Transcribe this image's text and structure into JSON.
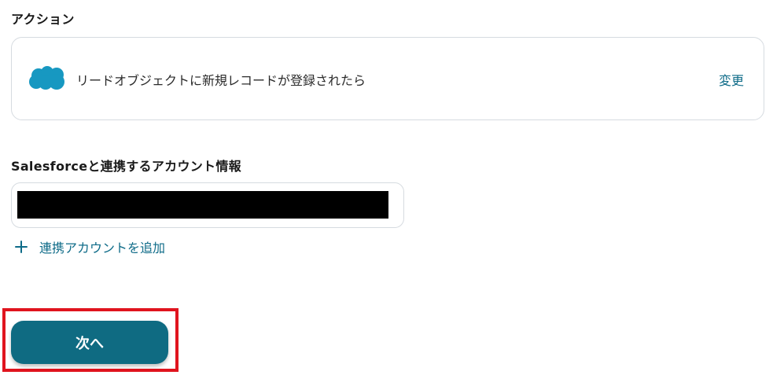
{
  "action_section": {
    "label": "アクション",
    "card": {
      "logo_icon": "salesforce-cloud-icon",
      "text": "リードオブジェクトに新規レコードが登録されたら",
      "change_label": "変更"
    }
  },
  "account_section": {
    "label": "Salesforceと連携するアカウント情報",
    "add_account_label": "連携アカウントを追加"
  },
  "footer": {
    "next_label": "次へ"
  },
  "colors": {
    "accent": "#0e6b88",
    "button": "#0f6b82",
    "highlight": "#e0141e",
    "salesforce": "#1798c1"
  }
}
